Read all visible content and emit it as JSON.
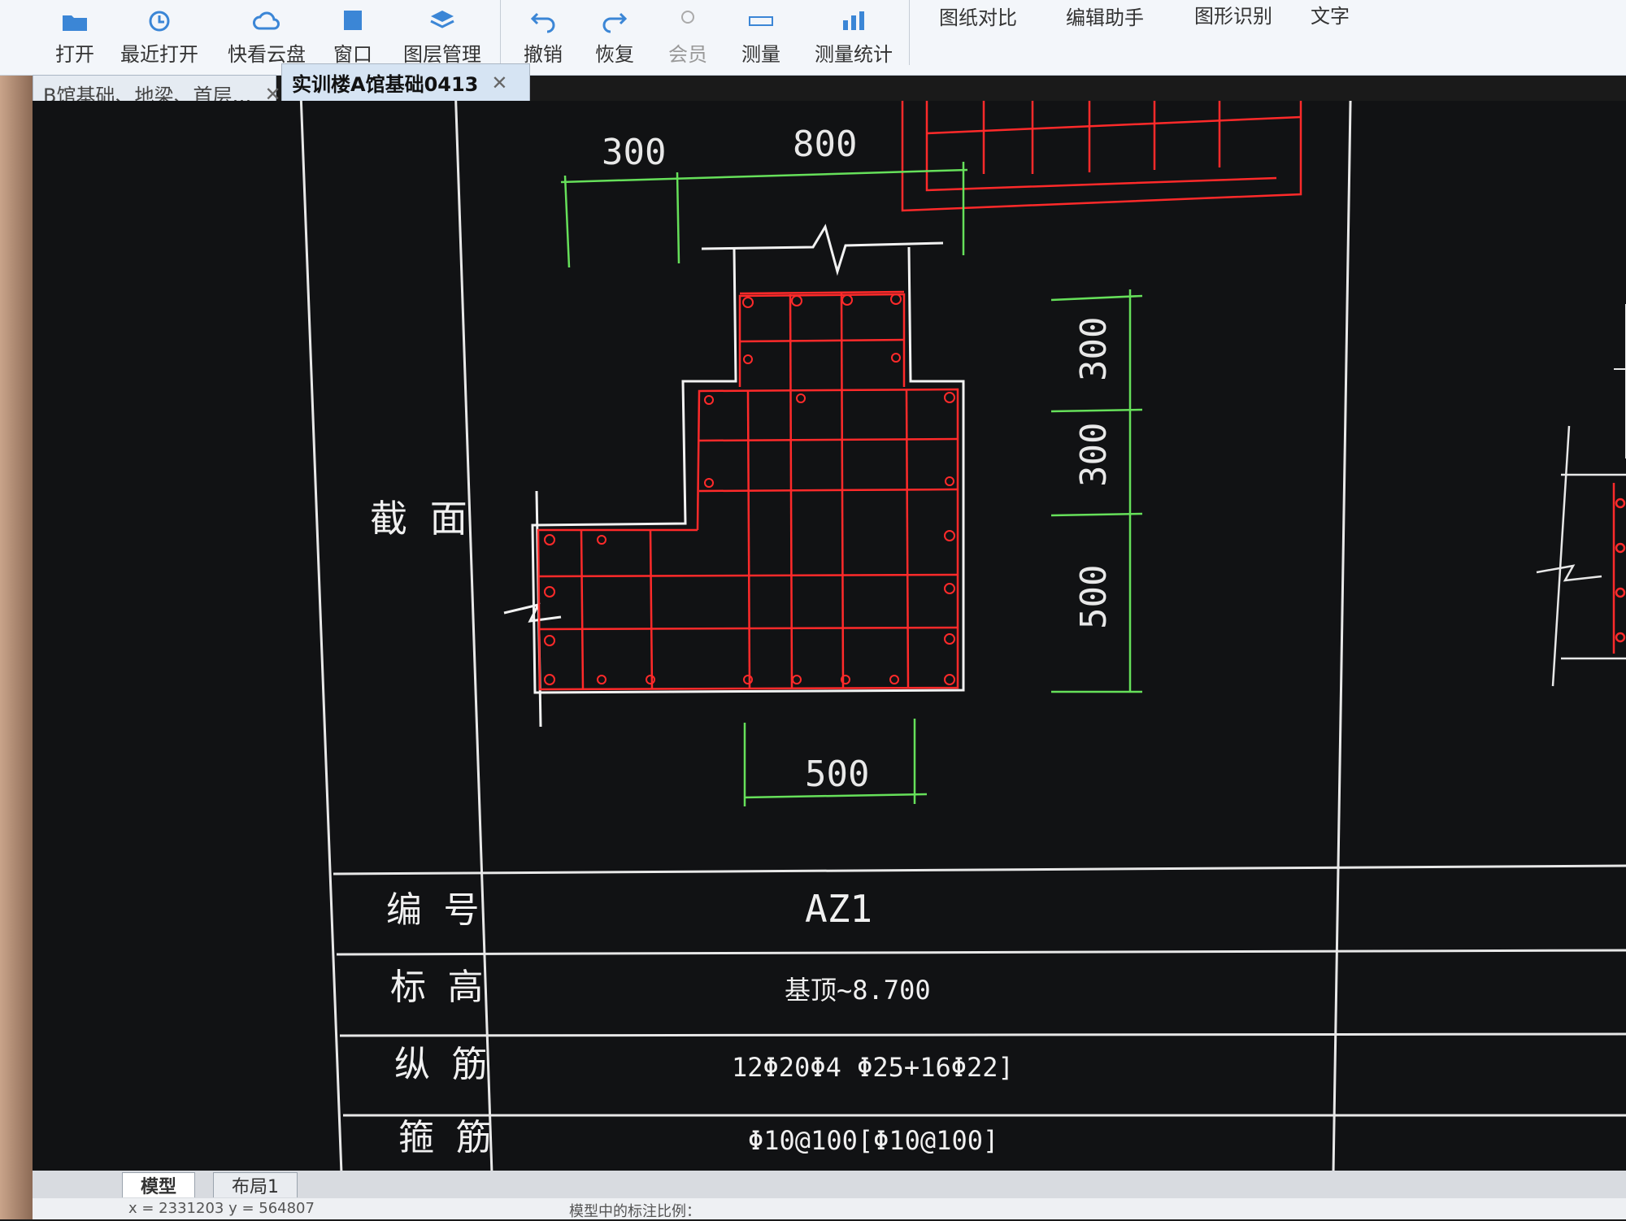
{
  "toolbar": {
    "buttons": [
      {
        "label": "打开",
        "icon": "folder-open-icon"
      },
      {
        "label": "最近打开",
        "icon": "recent-clock-icon"
      },
      {
        "label": "快看云盘",
        "icon": "cloud-icon"
      },
      {
        "label": "窗口",
        "icon": "window-icon"
      },
      {
        "label": "图层管理",
        "icon": "layers-icon"
      },
      {
        "label": "撤销",
        "icon": "undo-icon"
      },
      {
        "label": "恢复",
        "icon": "redo-icon"
      },
      {
        "label": "会员",
        "icon": "member-icon"
      },
      {
        "label": "测量",
        "icon": "measure-icon"
      },
      {
        "label": "测量统计",
        "icon": "measure-stats-icon"
      },
      {
        "label": "图纸对比",
        "icon": "compare-icon"
      },
      {
        "label": "编辑助手",
        "icon": "edit-assistant-icon"
      },
      {
        "label": "图形识别",
        "icon": "shape-recognize-icon"
      },
      {
        "label": "文字",
        "icon": "text-icon"
      }
    ]
  },
  "tabs": [
    {
      "label": "B馆基础、地梁、首层…",
      "active": false
    },
    {
      "label": "实训楼A馆基础0413",
      "active": true
    }
  ],
  "drawing": {
    "dimensions": {
      "top_left": "300",
      "top_right": "800",
      "right_top": "300",
      "right_mid": "300",
      "right_bottom": "500",
      "bottom": "500"
    },
    "table": {
      "section_label": "截 面",
      "rows": [
        {
          "label": "编 号",
          "value": "AZ1"
        },
        {
          "label": "标 高",
          "value": "基顶~8.700"
        },
        {
          "label": "纵 筋",
          "value": "12Φ20Φ4 Φ25+16Φ22]"
        },
        {
          "label": "箍 筋",
          "value": "Φ10@100[Φ10@100]"
        }
      ]
    },
    "colors": {
      "rebar": "#ff2a2a",
      "dimension": "#66e05a",
      "outline": "#f2f2f2",
      "background": "#111214"
    }
  },
  "layout_tabs": [
    {
      "label": "模型",
      "active": true
    },
    {
      "label": "布局1",
      "active": false
    }
  ],
  "status": {
    "coords": "x = 2331203  y = 564807",
    "hint": "模型中的标注比例："
  }
}
